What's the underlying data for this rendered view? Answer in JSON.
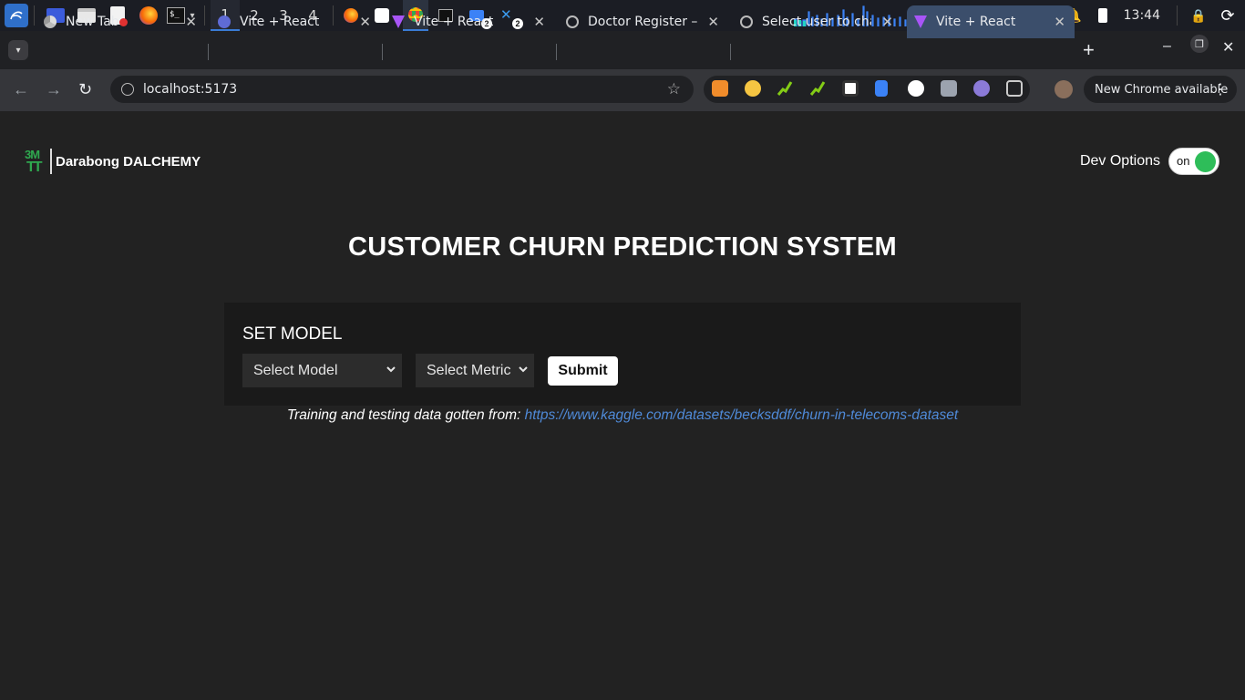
{
  "taskbar": {
    "workspaces": [
      "1",
      "2",
      "3",
      "4"
    ],
    "badges": [
      "2",
      "2"
    ],
    "clock": "13:44"
  },
  "tabs": [
    {
      "title": "New Tab"
    },
    {
      "title": "Vite + React"
    },
    {
      "title": "Vite + React"
    },
    {
      "title": "Doctor Register –"
    },
    {
      "title": "Select user to char"
    },
    {
      "title": "Vite + React",
      "active": true
    }
  ],
  "toolbar": {
    "url": "localhost:5173",
    "update_label": "New Chrome available"
  },
  "app": {
    "logo_text_top": "3M",
    "logo_text_bottom": "TT",
    "brand_name": "Darabong DALCHEMY",
    "dev_options_label": "Dev Options",
    "toggle_label": "on",
    "page_title": "CUSTOMER CHURN PREDICTION SYSTEM",
    "card_title": "SET MODEL",
    "model_select": "Select Model",
    "metric_select": "Select Metric",
    "submit_label": "Submit",
    "source_prefix": "Training and testing data gotten from:",
    "source_link": "https://www.kaggle.com/datasets/becksddf/churn-in-telecoms-dataset"
  },
  "colors": {
    "background": "#222222",
    "card": "#1a1a1a",
    "toggle_on": "#2ebd59",
    "link": "#4f8ad8"
  }
}
